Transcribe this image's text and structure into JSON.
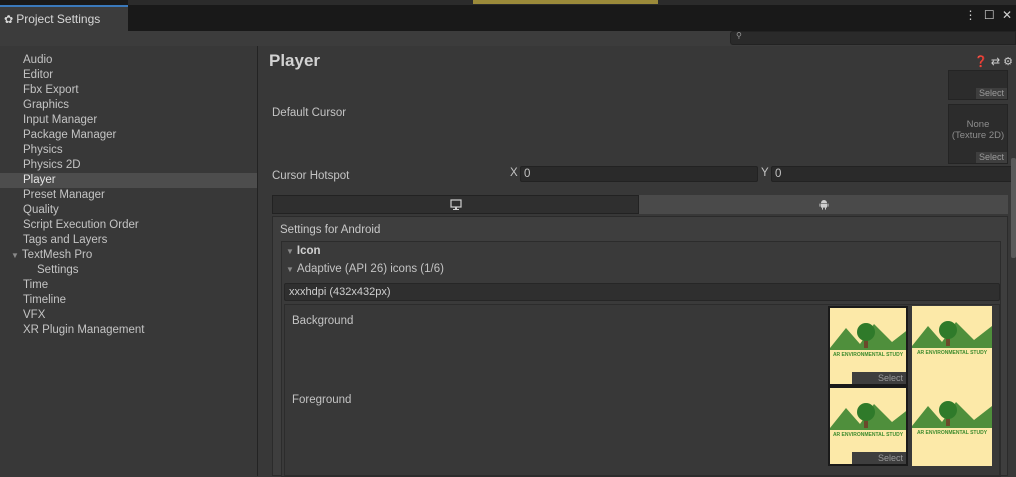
{
  "window": {
    "tab_title": "Project Settings",
    "controls": "⋮ ☐ ✕"
  },
  "search": {
    "placeholder": ""
  },
  "sidebar": {
    "items": [
      "Audio",
      "Editor",
      "Fbx Export",
      "Graphics",
      "Input Manager",
      "Package Manager",
      "Physics",
      "Physics 2D",
      "Player",
      "Preset Manager",
      "Quality",
      "Script Execution Order",
      "Tags and Layers",
      "TextMesh Pro",
      "Settings",
      "Time",
      "Timeline",
      "VFX",
      "XR Plugin Management"
    ],
    "selected": "Player"
  },
  "player": {
    "title": "Player",
    "default_cursor_label": "Default Cursor",
    "select_label": "Select",
    "none_texture": "None\n(Texture 2D)",
    "cursor_hotspot_label": "Cursor Hotspot",
    "x_label": "X",
    "x_value": "0",
    "y_label": "Y",
    "y_value": "0",
    "settings_for": "Settings for Android",
    "icon_section": "Icon",
    "adaptive_section": "Adaptive (API 26) icons (1/6)",
    "density": "xxxhdpi (432x432px)",
    "background_label": "Background",
    "foreground_label": "Foreground",
    "thumb_caption": "AR ENVIRONMENTAL STUDY"
  },
  "colors": {
    "accent": "#3a79bb",
    "panel_bg": "#383838",
    "thumb_bg": "#fce9a8",
    "thumb_green": "#3d8b2e"
  },
  "icons": [
    "gear-icon",
    "search-icon",
    "help-icon",
    "preset-icon",
    "settings-icon",
    "monitor-icon",
    "android-icon"
  ]
}
